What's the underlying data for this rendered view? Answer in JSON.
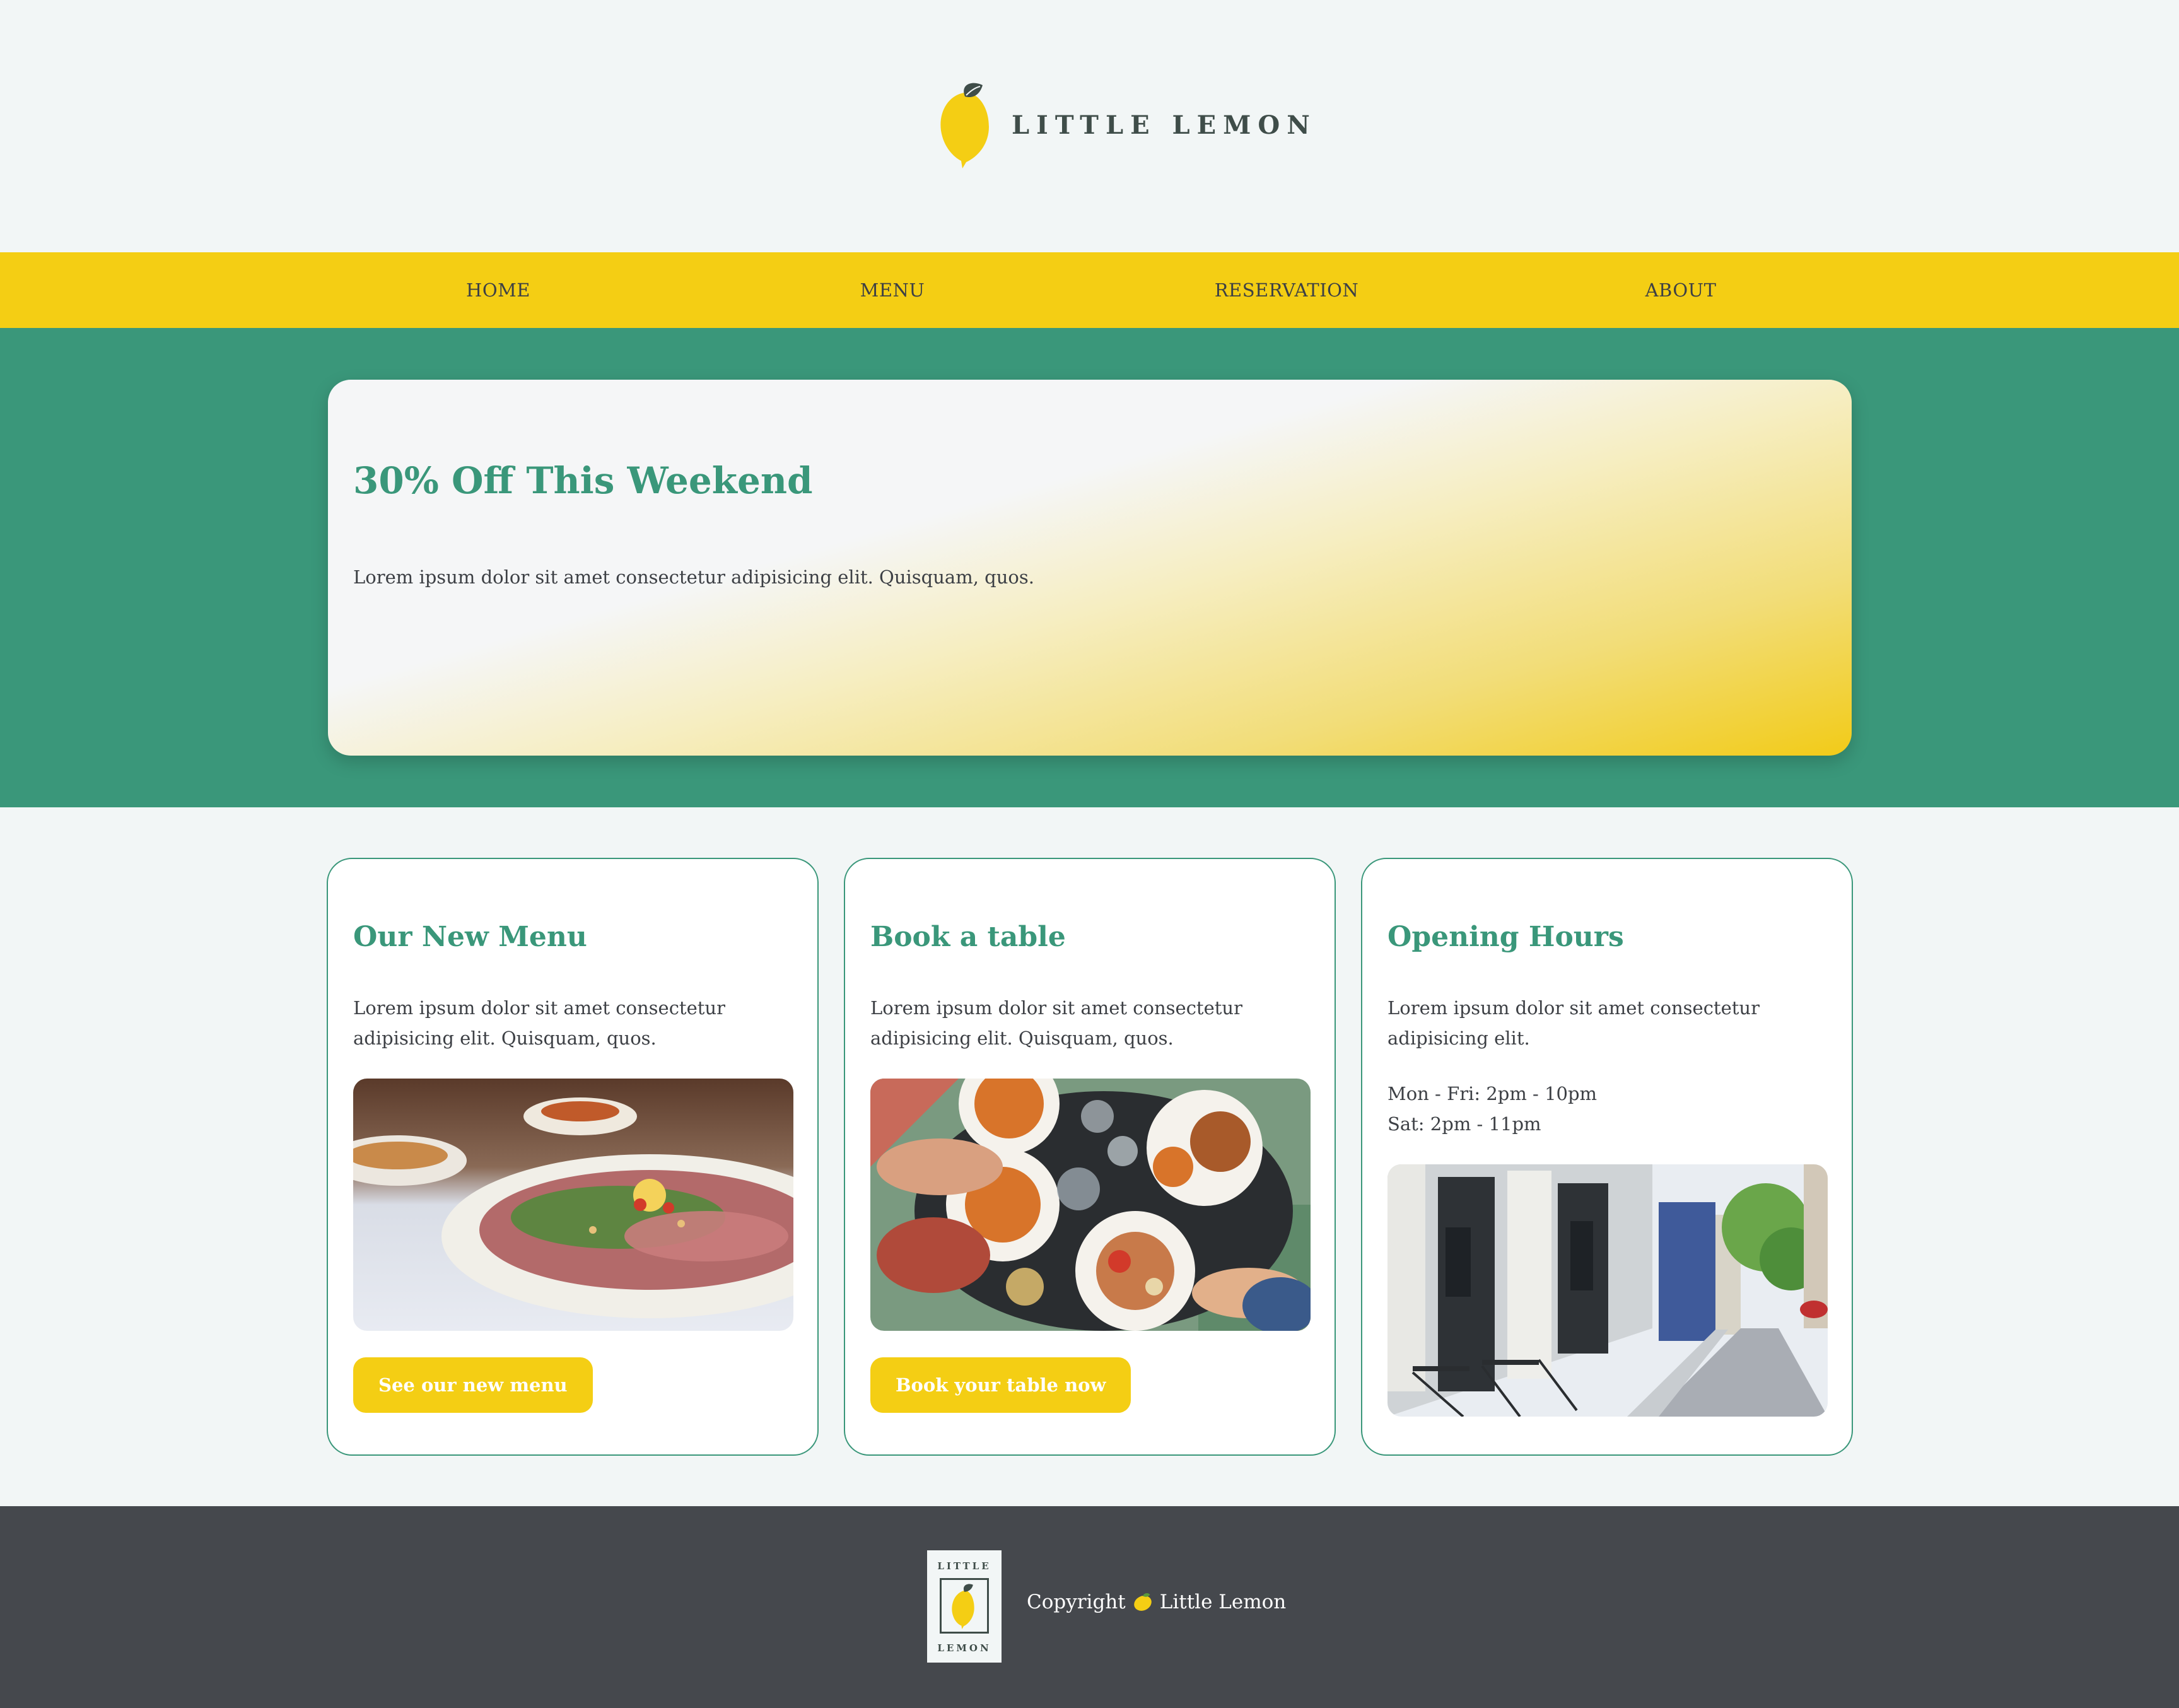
{
  "brand": {
    "name": "LITTLE LEMON",
    "logo_icon": "lemon-icon"
  },
  "nav": {
    "items": [
      {
        "label": "HOME"
      },
      {
        "label": "MENU"
      },
      {
        "label": "RESERVATION"
      },
      {
        "label": "ABOUT"
      }
    ]
  },
  "hero": {
    "title": "30% Off This Weekend",
    "text": "Lorem ipsum dolor sit amet consectetur adipisicing elit. Quisquam, quos."
  },
  "cards": [
    {
      "title": "Our New Menu",
      "text": "Lorem ipsum dolor sit amet consectetur adipisicing elit. Quisquam, quos.",
      "image": "food-dish-photo",
      "button": "See our new menu"
    },
    {
      "title": "Book a table",
      "text": "Lorem ipsum dolor sit amet consectetur adipisicing elit. Quisquam, quos.",
      "image": "dining-table-photo",
      "button": "Book your table now"
    },
    {
      "title": "Opening Hours",
      "text": "Lorem ipsum dolor sit amet consectetur adipisicing elit.",
      "hours": [
        "Mon - Fri: 2pm - 10pm",
        "Sat: 2pm - 11pm"
      ],
      "image": "street-cafe-photo"
    }
  ],
  "footer": {
    "logo_top": "LITTLE",
    "logo_bottom": "LEMON",
    "copyright_prefix": "Copyright",
    "copyright_icon": "lemon-emoji-icon",
    "copyright_name": "Little Lemon"
  },
  "colors": {
    "primary_green": "#3a977a",
    "primary_yellow": "#f4ce14",
    "dark": "#45484d",
    "background": "#f2f6f6"
  }
}
